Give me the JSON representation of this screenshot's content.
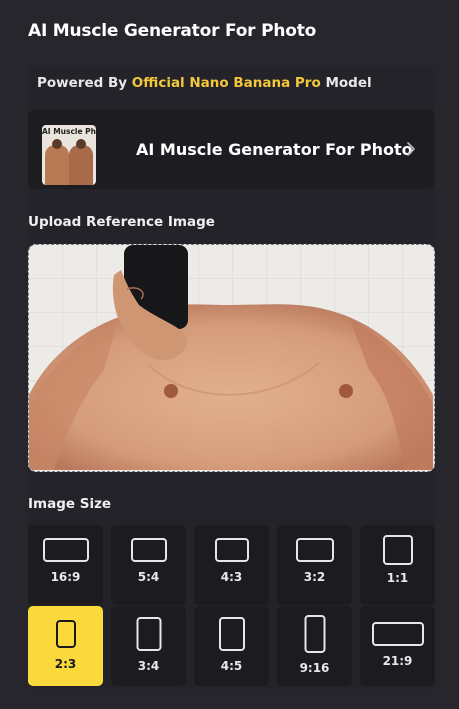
{
  "header": {
    "title": "AI Muscle Generator For Photo"
  },
  "powered": {
    "prefix": "Powered By",
    "highlight": "Official Nano Banana Pro",
    "suffix": "Model"
  },
  "model_card": {
    "thumb_text": "AI Muscle Photo",
    "name": "AI Muscle Generator For Photo",
    "icon": "chevron-right-icon"
  },
  "upload": {
    "label": "Upload Reference Image"
  },
  "image_size": {
    "label": "Image Size",
    "selected": "2:3",
    "options": [
      {
        "label": "16:9"
      },
      {
        "label": "5:4"
      },
      {
        "label": "4:3"
      },
      {
        "label": "3:2"
      },
      {
        "label": "1:1"
      },
      {
        "label": "2:3"
      },
      {
        "label": "3:4"
      },
      {
        "label": "4:5"
      },
      {
        "label": "9:16"
      },
      {
        "label": "21:9"
      }
    ]
  },
  "colors": {
    "background": "#26262c",
    "accent": "#f9d93b",
    "highlight_text": "#f2c83a"
  }
}
